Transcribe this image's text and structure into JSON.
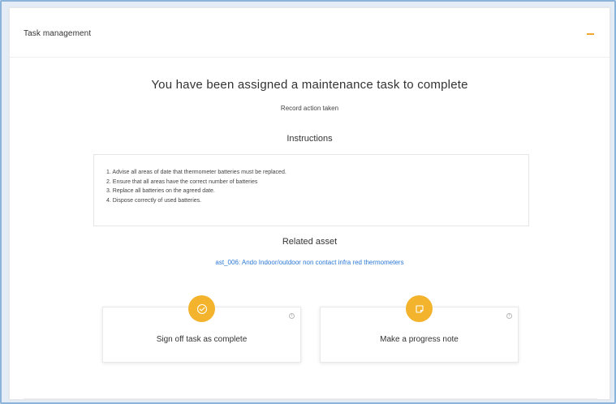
{
  "panel": {
    "title": "Task management",
    "collapse_icon": "minus-icon",
    "accent_color": "#f0a830"
  },
  "task": {
    "headline": "You have been assigned a maintenance task to complete",
    "subline": "Record action taken"
  },
  "instructions": {
    "title": "Instructions",
    "items": [
      "1. Advise all areas of date that thermometer batteries must be replaced.",
      "2. Ensure that all areas have the correct number of batteries",
      "3. Replace all batteries on the agreed date.",
      "4. Dispose correctly of used batteries."
    ]
  },
  "related_asset": {
    "title": "Related asset",
    "link_text": "ast_006: Ando Indoor/outdoor non contact infra red thermometers",
    "link_color": "#2b78d6"
  },
  "actions": [
    {
      "label": "Sign off task as complete",
      "icon": "check-circle-icon",
      "info_icon": "info-icon",
      "color": "#f3b32c"
    },
    {
      "label": "Make a progress note",
      "icon": "sticky-note-icon",
      "info_icon": "info-icon",
      "color": "#f3b32c"
    }
  ]
}
